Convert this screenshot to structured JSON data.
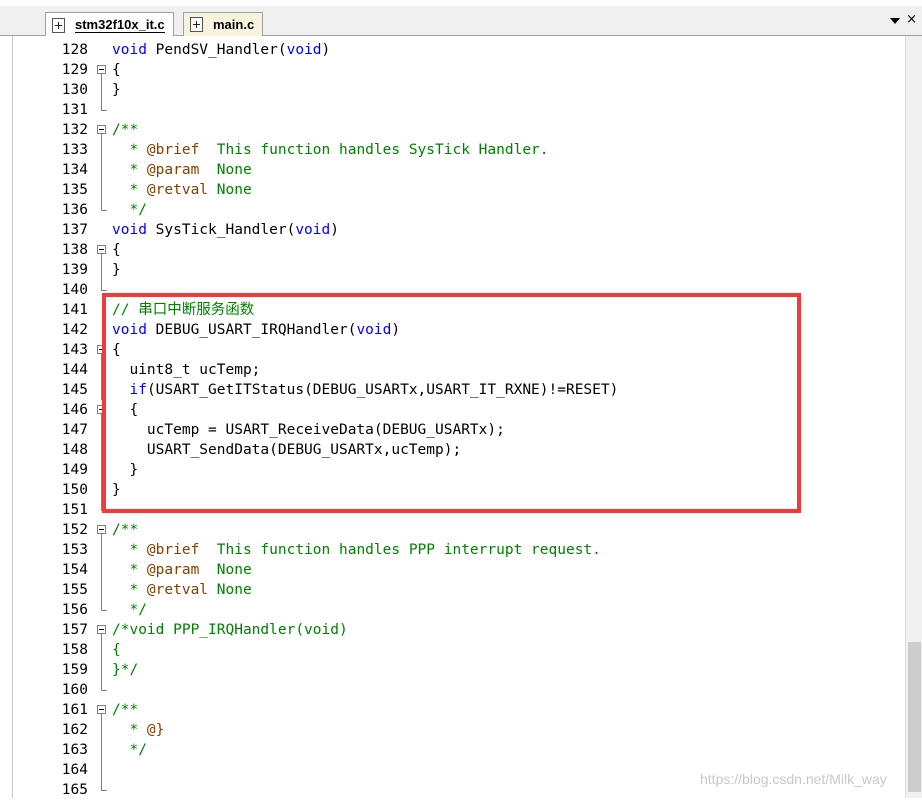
{
  "tabs": [
    {
      "label": "stm32f10x_it.c",
      "active": true
    },
    {
      "label": "main.c",
      "active": false
    }
  ],
  "tab_controls": {
    "menu_icon": "chevron-down-icon",
    "close_glyph": "×"
  },
  "watermark": "https://blog.csdn.net/Milk_way",
  "colors": {
    "keyword": "#0000ff",
    "comment": "#008000",
    "doc_tag": "#804000",
    "highlight": "#ef3b3b"
  },
  "lines": [
    {
      "n": "128",
      "fold": "none",
      "parts": [
        {
          "t": "void",
          "c": "kw"
        },
        {
          "t": " PendSV_Handler(",
          "c": ""
        },
        {
          "t": "void",
          "c": "kw"
        },
        {
          "t": ")",
          "c": ""
        }
      ]
    },
    {
      "n": "129",
      "fold": "start",
      "parts": [
        {
          "t": "{",
          "c": ""
        }
      ]
    },
    {
      "n": "130",
      "fold": "mid",
      "parts": [
        {
          "t": "}",
          "c": ""
        }
      ]
    },
    {
      "n": "131",
      "fold": "end",
      "parts": []
    },
    {
      "n": "132",
      "fold": "start",
      "parts": [
        {
          "t": "/**",
          "c": "cm"
        }
      ]
    },
    {
      "n": "133",
      "fold": "mid",
      "parts": [
        {
          "t": "  * ",
          "c": "cm"
        },
        {
          "t": "@brief",
          "c": "tag"
        },
        {
          "t": "  This function handles SysTick Handler.",
          "c": "cm"
        }
      ]
    },
    {
      "n": "134",
      "fold": "mid",
      "parts": [
        {
          "t": "  * ",
          "c": "cm"
        },
        {
          "t": "@param",
          "c": "tag"
        },
        {
          "t": "  None",
          "c": "cm"
        }
      ]
    },
    {
      "n": "135",
      "fold": "mid",
      "parts": [
        {
          "t": "  * ",
          "c": "cm"
        },
        {
          "t": "@retval",
          "c": "tag"
        },
        {
          "t": " None",
          "c": "cm"
        }
      ]
    },
    {
      "n": "136",
      "fold": "end",
      "parts": [
        {
          "t": "  */",
          "c": "cm"
        }
      ]
    },
    {
      "n": "137",
      "fold": "none",
      "parts": [
        {
          "t": "void",
          "c": "kw"
        },
        {
          "t": " SysTick_Handler(",
          "c": ""
        },
        {
          "t": "void",
          "c": "kw"
        },
        {
          "t": ")",
          "c": ""
        }
      ]
    },
    {
      "n": "138",
      "fold": "start",
      "parts": [
        {
          "t": "{",
          "c": ""
        }
      ]
    },
    {
      "n": "139",
      "fold": "mid",
      "parts": [
        {
          "t": "}",
          "c": ""
        }
      ]
    },
    {
      "n": "140",
      "fold": "end",
      "parts": []
    },
    {
      "n": "141",
      "fold": "none",
      "parts": [
        {
          "t": "// 串口中断服务函数",
          "c": "cm"
        }
      ]
    },
    {
      "n": "142",
      "fold": "none",
      "parts": [
        {
          "t": "void",
          "c": "kw"
        },
        {
          "t": " DEBUG_USART_IRQHandler(",
          "c": ""
        },
        {
          "t": "void",
          "c": "kw"
        },
        {
          "t": ")",
          "c": ""
        }
      ]
    },
    {
      "n": "143",
      "fold": "start",
      "parts": [
        {
          "t": "{",
          "c": ""
        }
      ]
    },
    {
      "n": "144",
      "fold": "mid",
      "parts": [
        {
          "t": "  uint8_t ucTemp;",
          "c": ""
        }
      ]
    },
    {
      "n": "145",
      "fold": "mid",
      "parts": [
        {
          "t": "  ",
          "c": ""
        },
        {
          "t": "if",
          "c": "kw"
        },
        {
          "t": "(USART_GetITStatus(DEBUG_USARTx,USART_IT_RXNE)!=RESET)",
          "c": ""
        }
      ]
    },
    {
      "n": "146",
      "fold": "start",
      "parts": [
        {
          "t": "  {",
          "c": ""
        }
      ]
    },
    {
      "n": "147",
      "fold": "mid",
      "parts": [
        {
          "t": "    ucTemp = USART_ReceiveData(DEBUG_USARTx);",
          "c": ""
        }
      ]
    },
    {
      "n": "148",
      "fold": "mid",
      "parts": [
        {
          "t": "    USART_SendData(DEBUG_USARTx,ucTemp);",
          "c": ""
        }
      ]
    },
    {
      "n": "149",
      "fold": "mid",
      "parts": [
        {
          "t": "  }",
          "c": ""
        }
      ]
    },
    {
      "n": "150",
      "fold": "mid",
      "parts": [
        {
          "t": "}",
          "c": ""
        }
      ]
    },
    {
      "n": "151",
      "fold": "end",
      "parts": []
    },
    {
      "n": "152",
      "fold": "start",
      "parts": [
        {
          "t": "/**",
          "c": "cm"
        }
      ]
    },
    {
      "n": "153",
      "fold": "mid",
      "parts": [
        {
          "t": "  * ",
          "c": "cm"
        },
        {
          "t": "@brief",
          "c": "tag"
        },
        {
          "t": "  This function handles PPP interrupt request.",
          "c": "cm"
        }
      ]
    },
    {
      "n": "154",
      "fold": "mid",
      "parts": [
        {
          "t": "  * ",
          "c": "cm"
        },
        {
          "t": "@param",
          "c": "tag"
        },
        {
          "t": "  None",
          "c": "cm"
        }
      ]
    },
    {
      "n": "155",
      "fold": "mid",
      "parts": [
        {
          "t": "  * ",
          "c": "cm"
        },
        {
          "t": "@retval",
          "c": "tag"
        },
        {
          "t": " None",
          "c": "cm"
        }
      ]
    },
    {
      "n": "156",
      "fold": "end",
      "parts": [
        {
          "t": "  */",
          "c": "cm"
        }
      ]
    },
    {
      "n": "157",
      "fold": "start",
      "parts": [
        {
          "t": "/*void PPP_IRQHandler(void)",
          "c": "cm"
        }
      ]
    },
    {
      "n": "158",
      "fold": "mid",
      "parts": [
        {
          "t": "{",
          "c": "cm"
        }
      ]
    },
    {
      "n": "159",
      "fold": "mid",
      "parts": [
        {
          "t": "}*/",
          "c": "cm"
        }
      ]
    },
    {
      "n": "160",
      "fold": "end",
      "parts": []
    },
    {
      "n": "161",
      "fold": "start",
      "parts": [
        {
          "t": "/**",
          "c": "cm"
        }
      ]
    },
    {
      "n": "162",
      "fold": "mid",
      "parts": [
        {
          "t": "  * ",
          "c": "cm"
        },
        {
          "t": "@}",
          "c": "tag"
        }
      ]
    },
    {
      "n": "163",
      "fold": "mid",
      "parts": [
        {
          "t": "  */",
          "c": "cm"
        }
      ]
    },
    {
      "n": "164",
      "fold": "mid",
      "parts": []
    },
    {
      "n": "165",
      "fold": "end",
      "parts": []
    }
  ]
}
